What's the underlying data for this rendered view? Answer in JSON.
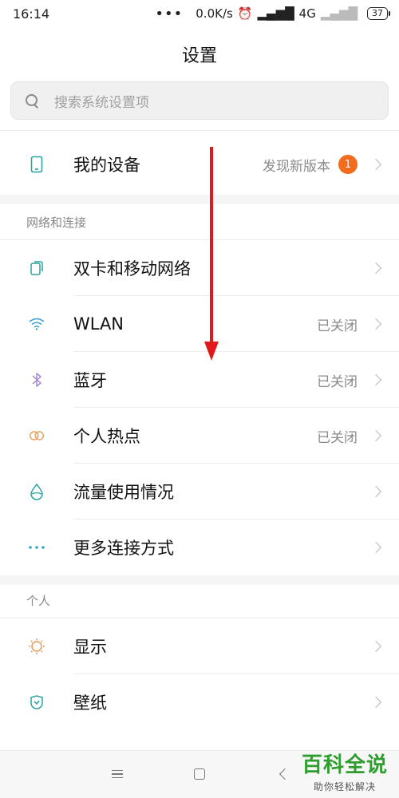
{
  "status_bar": {
    "time": "16:14",
    "dots": "•••",
    "speed": "0.0K/s",
    "network": "4G",
    "battery": "37"
  },
  "header": {
    "title": "设置"
  },
  "search": {
    "placeholder": "搜索系统设置项"
  },
  "device": {
    "label": "我的设备",
    "value": "发现新版本",
    "badge": "1"
  },
  "sections": {
    "network": {
      "title": "网络和连接",
      "items": [
        {
          "label": "双卡和移动网络",
          "value": ""
        },
        {
          "label": "WLAN",
          "value": "已关闭"
        },
        {
          "label": "蓝牙",
          "value": "已关闭"
        },
        {
          "label": "个人热点",
          "value": "已关闭"
        },
        {
          "label": "流量使用情况",
          "value": ""
        },
        {
          "label": "更多连接方式",
          "value": ""
        }
      ]
    },
    "personal": {
      "title": "个人",
      "items": [
        {
          "label": "显示",
          "value": ""
        },
        {
          "label": "壁纸",
          "value": ""
        }
      ]
    }
  },
  "icons": {
    "device": "phone-icon",
    "sim": "sim-card-icon",
    "wlan": "wifi-icon",
    "bluetooth": "bluetooth-icon",
    "hotspot": "hotspot-icon",
    "data_usage": "water-drop-icon",
    "more": "more-dots-icon",
    "display": "sun-icon",
    "wallpaper": "wallpaper-icon"
  },
  "colors": {
    "badge": "#f36b1c",
    "arrow": "#e0191c",
    "watermark": "#2f9e2f"
  },
  "watermark": {
    "title": "百科全说",
    "subtitle": "助你轻松解决"
  }
}
